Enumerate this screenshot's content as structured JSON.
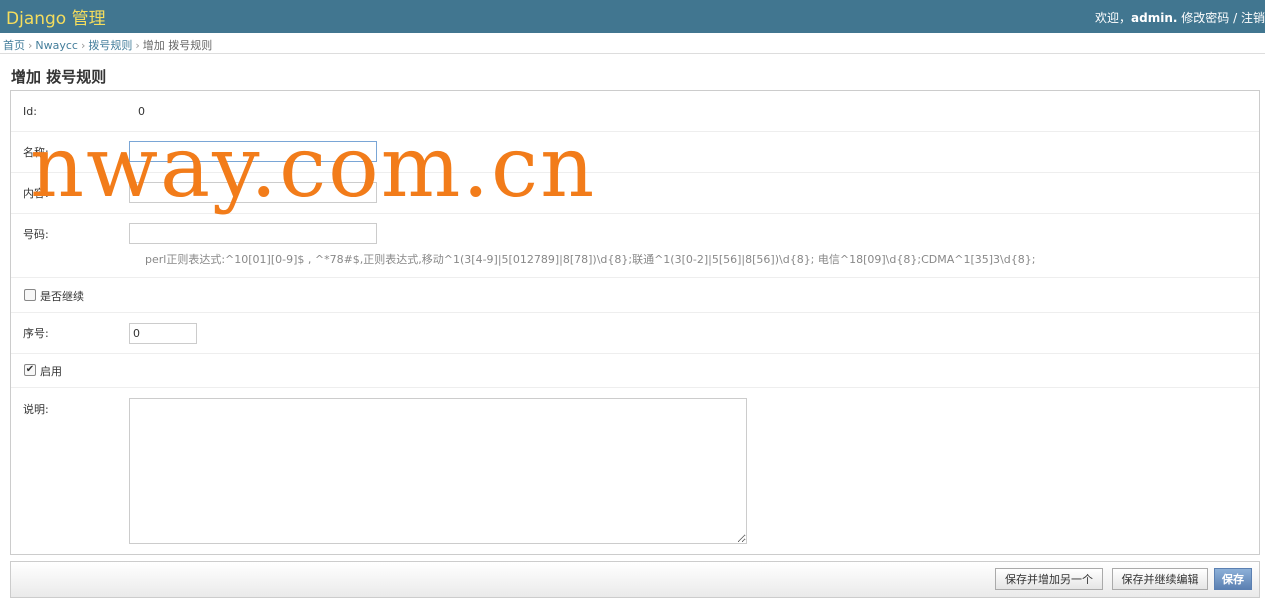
{
  "header": {
    "branding": "Django 管理",
    "welcome": "欢迎，",
    "username": "admin.",
    "change_password": "修改密码",
    "separator": "/",
    "logout": "注销"
  },
  "breadcrumbs": {
    "home": "首页",
    "app": "Nwaycc",
    "model": "拨号规则",
    "current": "增加 拨号规则",
    "separator": "›"
  },
  "page": {
    "title": "增加 拨号规则"
  },
  "form": {
    "id": {
      "label": "Id:",
      "value": "0"
    },
    "name": {
      "label": "名称:",
      "value": ""
    },
    "content": {
      "label": "内容:",
      "value": ""
    },
    "number": {
      "label": "号码:",
      "value": "",
      "help": "perl正则表达式:^10[01][0-9]$ , ^*78#$,正则表达式,移动^1(3[4-9]|5[012789]|8[78])\\d{8};联通^1(3[0-2]|5[56]|8[56])\\d{8}; 电信^18[09]\\d{8};CDMA^1[35]3\\d{8};"
    },
    "inherit": {
      "label": "是否继续",
      "checked": false
    },
    "order": {
      "label": "序号:",
      "value": "0"
    },
    "enabled": {
      "label": "启用",
      "checked": true,
      "check_glyph": "✔"
    },
    "description": {
      "label": "说明:",
      "value": ""
    }
  },
  "submit_row": {
    "save_add_another": "保存并增加另一个",
    "save_continue": "保存并继续编辑",
    "save": "保存"
  },
  "watermark": "nway.com.cn",
  "colors": {
    "header_bg": "#417690",
    "branding": "#f5dd5d",
    "link": "#447e9b",
    "watermark": "#f27c1a",
    "save_button": "#5b80b2"
  }
}
